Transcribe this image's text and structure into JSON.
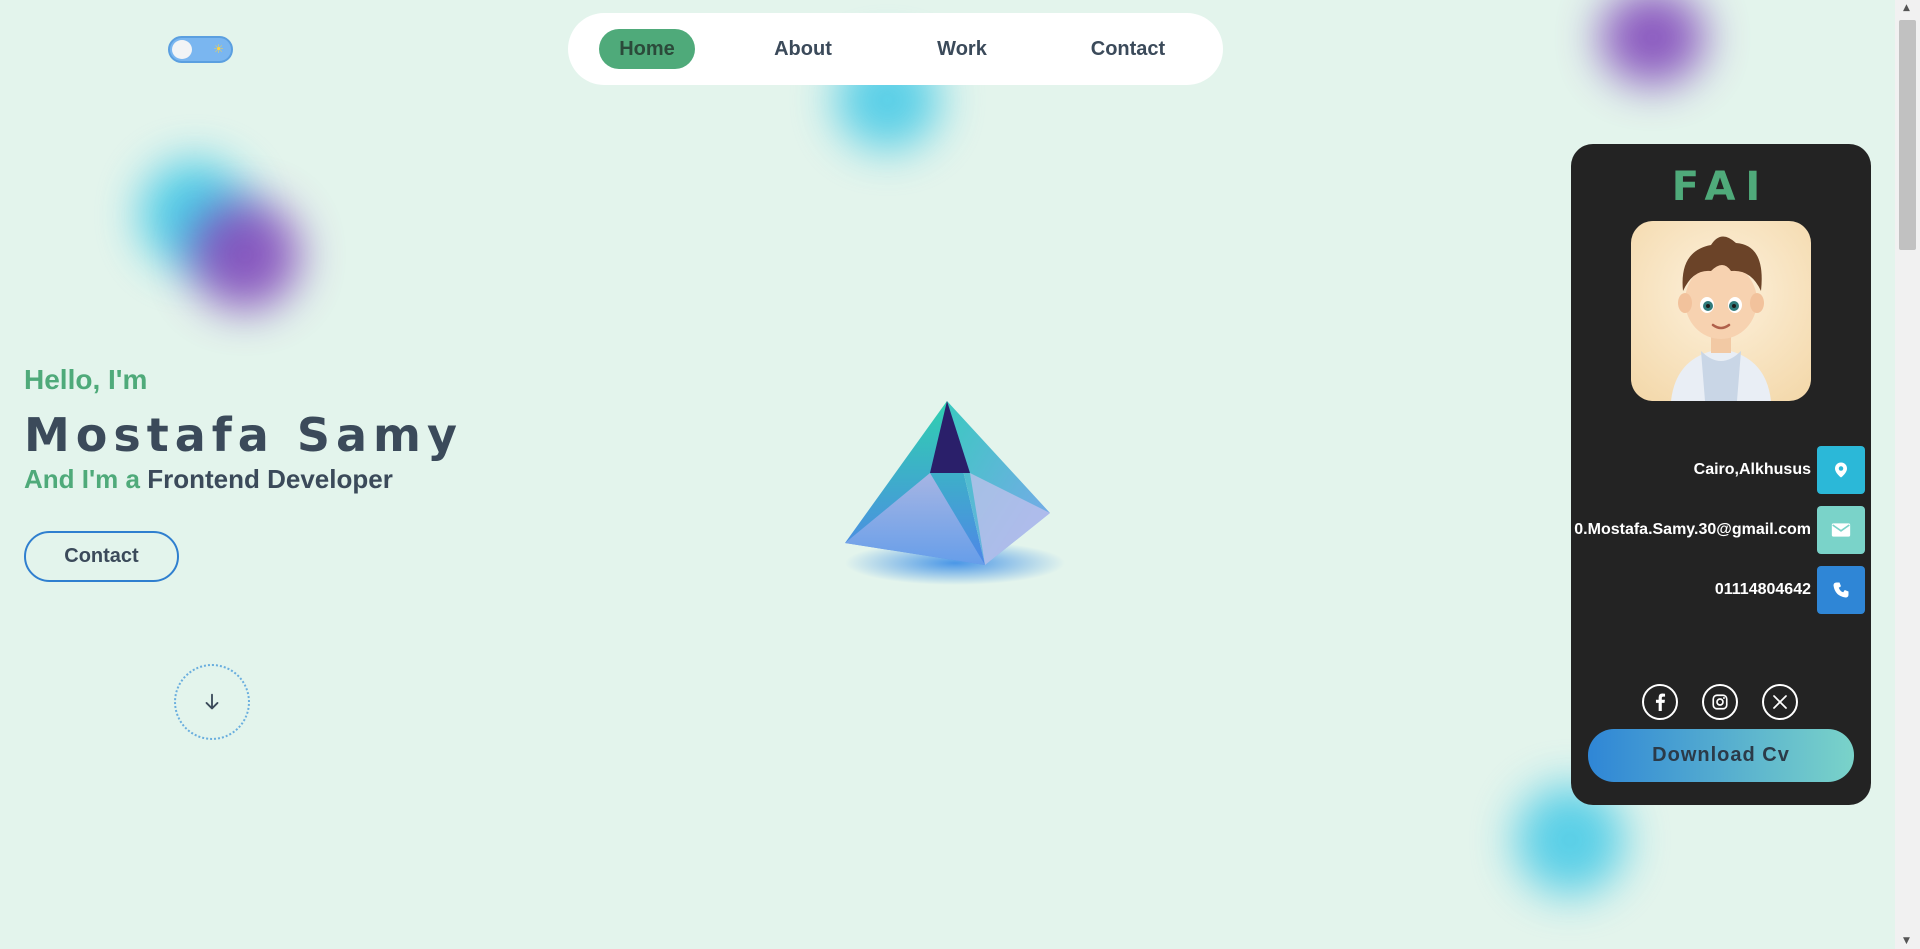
{
  "nav": {
    "items": [
      {
        "label": "Home",
        "active": true
      },
      {
        "label": "About",
        "active": false
      },
      {
        "label": "Work",
        "active": false
      },
      {
        "label": "Contact",
        "active": false
      }
    ]
  },
  "theme_toggle": {
    "icon": "sun-icon",
    "state": "light"
  },
  "hero": {
    "greeting": "Hello, I'm",
    "name": "Mostafa Samy",
    "role_prefix": "And I'm a",
    "role": "Frontend Developer",
    "contact_button": "Contact",
    "scroll_icon": "arrow-down-icon"
  },
  "card": {
    "logo": "FAI",
    "location": "Cairo,Alkhusus",
    "email": "0.Mostafa.Samy.30@gmail.com",
    "phone": "01114804642",
    "social": [
      "facebook-icon",
      "instagram-icon",
      "x-icon"
    ],
    "download_button": "Download Cv"
  },
  "colors": {
    "background": "#e3f4ec",
    "accent_green": "#4faa7a",
    "card_bg": "#232323",
    "location_icon_bg": "#2bb8d8",
    "email_icon_bg": "#7ad3c9",
    "phone_icon_bg": "#2f86d6"
  }
}
